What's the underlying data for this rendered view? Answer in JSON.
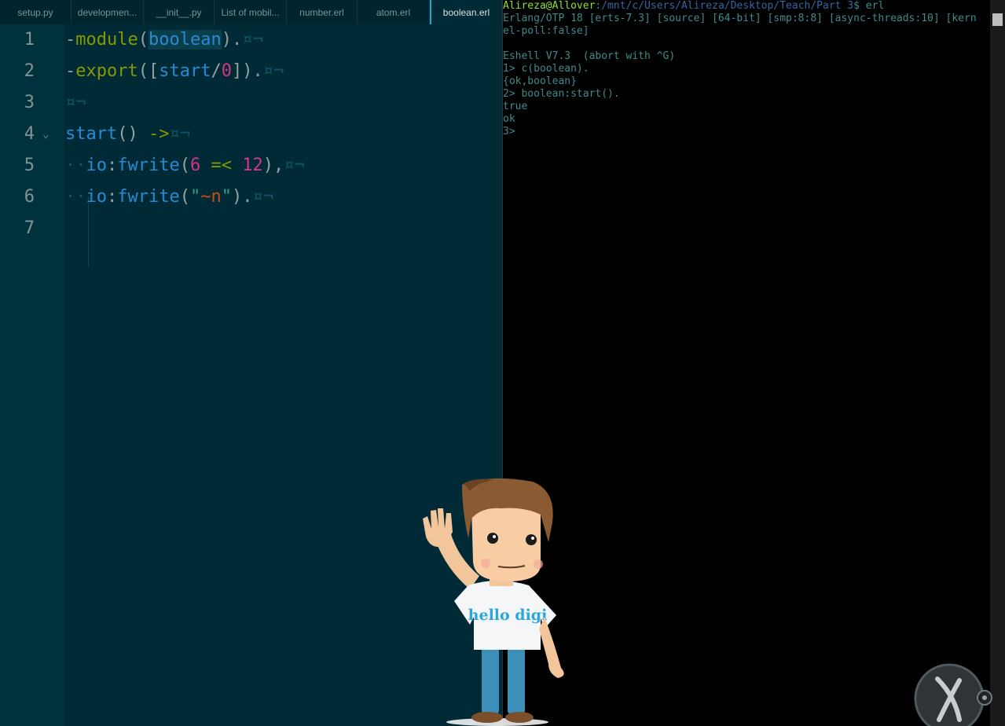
{
  "tabs": [
    {
      "label": "setup.py",
      "active": false
    },
    {
      "label": "developmen...",
      "active": false
    },
    {
      "label": "__init__.py",
      "active": false
    },
    {
      "label": "List of mobil...",
      "active": false
    },
    {
      "label": "number.erl",
      "active": false
    },
    {
      "label": "atom.erl",
      "active": false
    },
    {
      "label": "boolean.erl",
      "active": true
    }
  ],
  "editor": {
    "line_numbers": [
      "1",
      "2",
      "3",
      "4",
      "5",
      "6",
      "7"
    ],
    "fold_marker": "⌄",
    "invisible_marker": "¤¬",
    "indent_dots": "··",
    "lines": {
      "l1": {
        "dash": "-",
        "kw": "module",
        "open": "(",
        "atom": "boolean",
        "close": ").",
        "eol": "¤¬"
      },
      "l2": {
        "dash": "-",
        "kw": "export",
        "open": "([",
        "fn": "start",
        "slash": "/",
        "arity": "0",
        "close": "]).",
        "eol": "¤¬"
      },
      "l3": {
        "eol": "¤¬"
      },
      "l4": {
        "fn": "start",
        "parens": "()",
        "arrow": "->",
        "eol": "¤¬"
      },
      "l5": {
        "mod": "io",
        "colon": ":",
        "fn": "fwrite",
        "open": "(",
        "n1": "6",
        "op": "=<",
        "n2": "12",
        "close": "),",
        "eol": "¤¬"
      },
      "l6": {
        "mod": "io",
        "colon": ":",
        "fn": "fwrite",
        "open": "(",
        "q1": "\"",
        "esc": "~n",
        "q2": "\"",
        "close": ").",
        "eol": "¤¬"
      }
    }
  },
  "terminal": {
    "prompt_user": "Alireza@Allover",
    "prompt_sep": ":",
    "prompt_path": "/mnt/c/Users/Alireza/Desktop/Teach/Part 3",
    "prompt_end": "$ erl",
    "lines": [
      "Erlang/OTP 18 [erts-7.3] [source] [64-bit] [smp:8:8] [async-threads:10] [kern",
      "el-poll:false]",
      "",
      "Eshell V7.3  (abort with ^G)",
      "1> c(boolean).",
      "{ok,boolean}",
      "2> boolean:start().",
      "true",
      "ok",
      "3> "
    ]
  },
  "mascot": {
    "shirt_text": "hello digi"
  },
  "colors": {
    "editor_bg": "#002b36",
    "terminal_bg": "#000000",
    "keyword": "#859900",
    "atom": "#268bd2",
    "number": "#d33682",
    "string": "#2aa198",
    "prompt_user": "#8ae234",
    "prompt_path": "#3465a4"
  }
}
